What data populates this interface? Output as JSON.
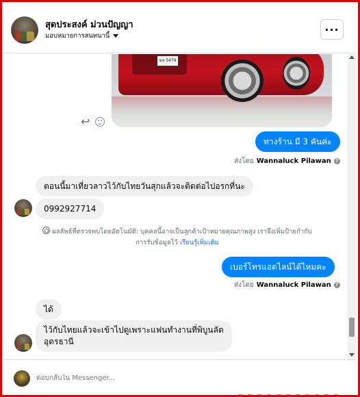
{
  "header": {
    "name": "สุดประสงค์ ม่วนปัญญา",
    "subtitle": "มอบหมายการสนทนานี้",
    "more_label": "···"
  },
  "car_image": {
    "plate_text": "ฆจ 5479"
  },
  "messages": [
    {
      "id": "m1",
      "direction": "out",
      "text": "ทางร้าน มี 3 คันค่ะ"
    },
    {
      "id": "m2",
      "direction": "in",
      "text": "ตอนนี้มาเที่ยวลาวไว้กับไทยวันสุกแล้วจะติดต่อไปอรกที่นะ"
    },
    {
      "id": "m3",
      "direction": "in",
      "text": "0992927714"
    },
    {
      "id": "m4",
      "direction": "out",
      "text": "เบอร์โทรแอดไลน์ได้ไหมคะ"
    },
    {
      "id": "m5",
      "direction": "in",
      "text": "ได้"
    },
    {
      "id": "m6",
      "direction": "in",
      "text": "ไว้กับไทยแล้วจะเข้าไปดูเพราะแฟนทำงานที่พิบูนลัด"
    },
    {
      "id": "m6b",
      "direction": "in",
      "text": "อุดรธานี"
    }
  ],
  "sent_by": {
    "prefix": "ส่งโดย",
    "name": "Wannaluck Pilawan",
    "help": "?"
  },
  "auto_note": {
    "text": "ผลลัพธ์ที่ตรวจพบโดยอัตโนมัติ: บุคคลนี้อาจเป็นลูกค้าเป้าหมายคุณภาพสูง เราจึงเพิ่มป้ายกำกับ",
    "text2": "การรับข้อมูลไว้",
    "link": "เรียนรู้เพิ่มเติม"
  },
  "composer": {
    "placeholder": "ตอบกลับใน Messenger..."
  }
}
